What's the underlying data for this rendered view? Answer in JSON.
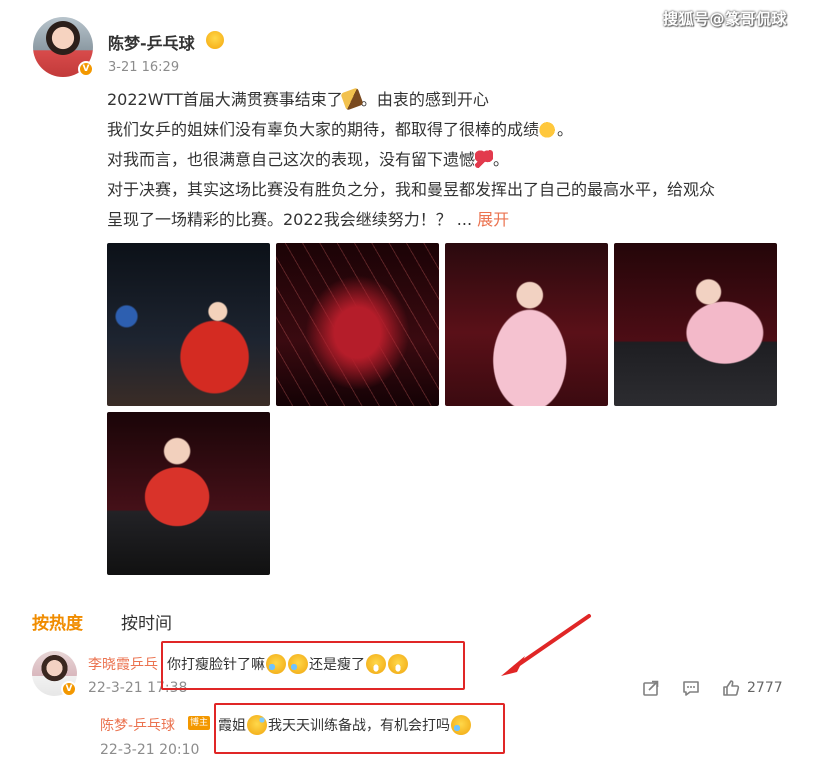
{
  "watermark": "搜狐号@篆哥侃球",
  "post": {
    "author": "陈梦-乒乓球",
    "timestamp": "3-21 16:29",
    "lines": [
      "2022WTT首届大满贯赛事结束了",
      "。由衷的感到开心",
      "我们女乒的姐妹们没有辜负大家的期待，都取得了很棒的成绩",
      "。",
      "对我而言，也很满意自己这次的表现，没有留下遗憾",
      "。",
      "对于决赛，其实这场比赛没有胜负之分，我和曼昱都发挥出了自己的最高水平，给观众",
      "呈现了一场精彩的比赛。2022我会继续努力！？ ... "
    ],
    "expand_label": "展开",
    "images": [
      "trophy-photo",
      "arena-lights-photo",
      "player-pink-photo",
      "player-pink-table-photo",
      "player-red-photo"
    ]
  },
  "comments": {
    "sort_tabs": [
      "按热度",
      "按时间"
    ],
    "active_tab": "按热度",
    "top_comment": {
      "user": "李晓霞乒乓",
      "text_a": "你打瘦脸针了嘛",
      "text_b": "还是瘦了",
      "time": "22-3-21 17:38",
      "like_count": "2777"
    },
    "reply": {
      "user": "陈梦-乒乓球",
      "tag": "博主",
      "text_a": "霞姐",
      "text_b": "我天天训练备战，有机会打吗",
      "time": "22-3-21 20:10"
    }
  },
  "colors": {
    "accent": "#eb7350",
    "active_tab": "#f08c00",
    "annotation": "#e02626",
    "badge": "#f39800"
  },
  "icons": [
    "verified-badge-icon",
    "share-icon",
    "comment-icon",
    "like-icon"
  ]
}
